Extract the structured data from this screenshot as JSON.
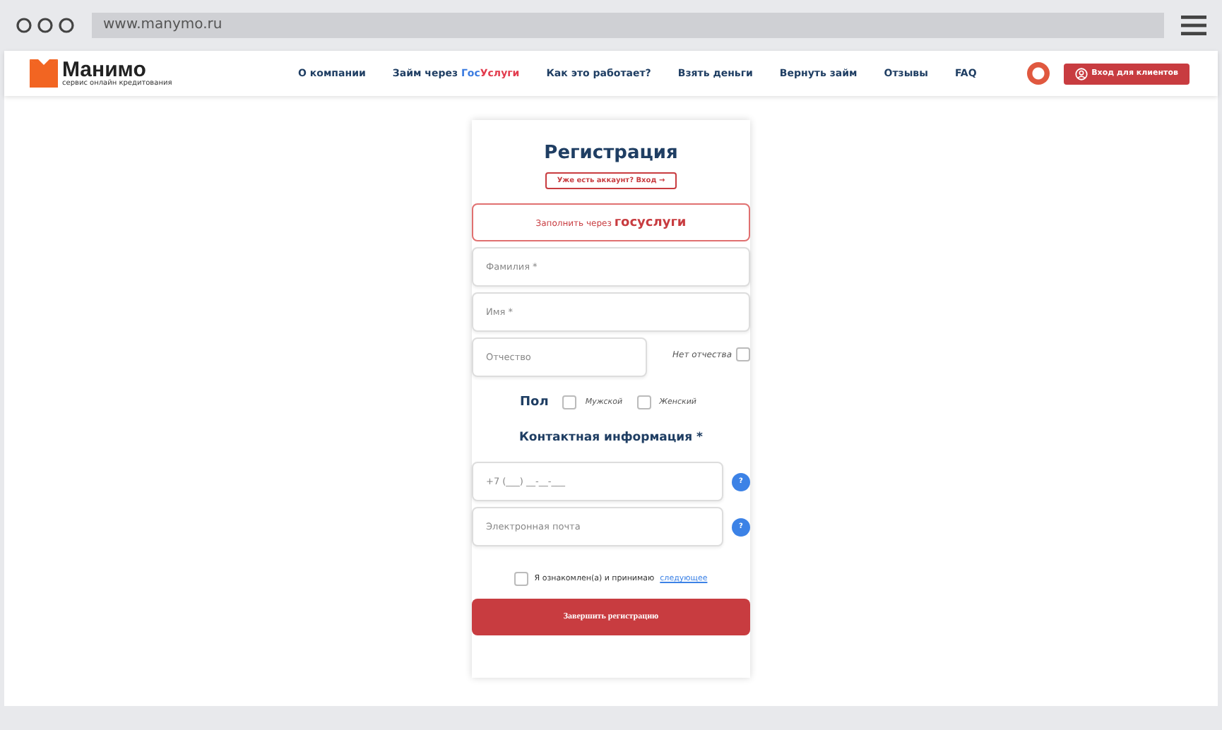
{
  "browser": {
    "url": "www.manymo.ru"
  },
  "header": {
    "logo": {
      "name": "Манимо",
      "tagline": "сервис онлайн кредитования"
    },
    "nav": [
      {
        "label": "О компании"
      },
      {
        "label": "Займ через ",
        "brand_a": "Гос",
        "brand_b": "Услуги"
      },
      {
        "label": "Как это работает?"
      },
      {
        "label": "Взять деньги"
      },
      {
        "label": "Вернуть займ"
      },
      {
        "label": "Отзывы"
      },
      {
        "label": "FAQ"
      }
    ],
    "login_button": "Вход для клиентов"
  },
  "form": {
    "title": "Регистрация",
    "account_link": "Уже есть аккаунт? Вход",
    "account_arrow": "→",
    "gosuslugi_button": {
      "label": "Заполнить через",
      "brand": "госуслуги"
    },
    "fields": [
      {
        "placeholder": "Фамилия *"
      },
      {
        "placeholder": "Имя *"
      }
    ],
    "patronymic": {
      "placeholder": "Отчество",
      "no_patronymic": {
        "label": "Нет отчества",
        "checked": false
      }
    },
    "gender": {
      "label": "Пол",
      "options": [
        {
          "label": "Мужской",
          "selected": false
        },
        {
          "label": "Женский",
          "selected": false
        }
      ]
    },
    "contact_title": "Контактная информация *",
    "contact_fields": [
      {
        "placeholder": "+7 (___) __-__-___",
        "help": "?"
      },
      {
        "placeholder": "Электронная почта",
        "help": "?"
      }
    ],
    "agreement": {
      "text": "Я ознакомлен(а) и принимаю",
      "link": "следующее",
      "checked": false
    },
    "submit": "Завершить регистрацию"
  }
}
